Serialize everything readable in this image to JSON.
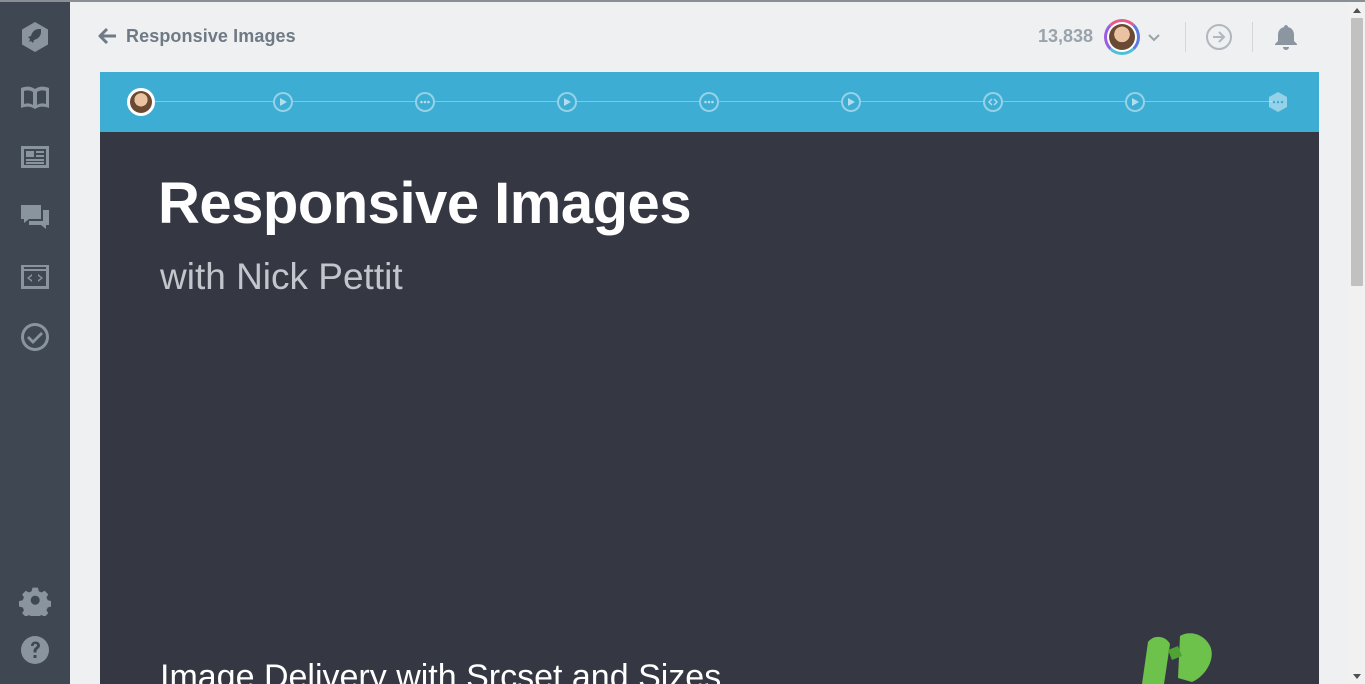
{
  "header": {
    "back_label": "Responsive Images",
    "points": "13,838"
  },
  "course": {
    "title": "Responsive Images",
    "subtitle": "with Nick Pettit",
    "lesson_title": "Image Delivery with Srcset and Sizes"
  },
  "sidebar": {
    "items": [
      {
        "icon": "rocket-icon"
      },
      {
        "icon": "library-book-icon"
      },
      {
        "icon": "news-icon"
      },
      {
        "icon": "community-chat-icon"
      },
      {
        "icon": "workspaces-code-icon"
      },
      {
        "icon": "check-circle-icon"
      },
      {
        "icon": "gear-icon"
      },
      {
        "icon": "help-icon"
      }
    ]
  },
  "progress_steps": [
    {
      "type": "avatar"
    },
    {
      "type": "video"
    },
    {
      "type": "quiz"
    },
    {
      "type": "video"
    },
    {
      "type": "quiz"
    },
    {
      "type": "video"
    },
    {
      "type": "code-challenge"
    },
    {
      "type": "video"
    },
    {
      "type": "badge"
    }
  ],
  "colors": {
    "sidebar_bg": "#3f4852",
    "progress_bg": "#3eadd3",
    "card_bg": "#353842",
    "page_bg": "#eef0f2",
    "badge_green": "#6cc24a"
  }
}
